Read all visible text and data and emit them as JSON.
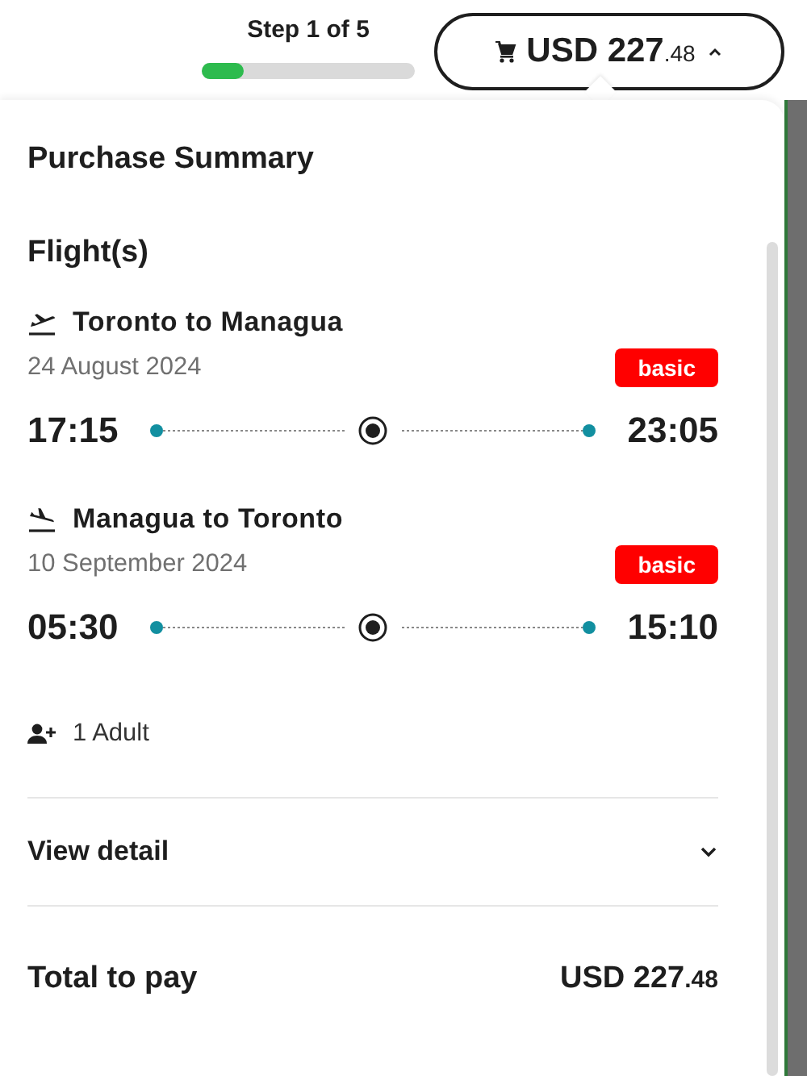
{
  "header": {
    "step": "Step 1 of 5",
    "progress": {
      "level": 0.2
    },
    "cart_button": {
      "amount": "USD 227",
      "cents": ".48",
      "expanded": true
    }
  },
  "summary": {
    "title": "Purchase Summary",
    "section_title": "Flight(s)",
    "flights": [
      {
        "kind": "departure",
        "route": "Toronto to Managua",
        "date": "24 August 2024",
        "fare": "basic",
        "depart_time": "17:15",
        "arrive_time": "23:05"
      },
      {
        "kind": "return",
        "route": "Managua to Toronto",
        "date": "10 September 2024",
        "fare": "basic",
        "depart_time": "05:30",
        "arrive_time": "15:10"
      }
    ],
    "passengers": "1 Adult",
    "view_detail": {
      "label": "View detail",
      "expanded": false
    },
    "total": {
      "label": "Total to pay",
      "amount": "USD 227",
      "cents": ".48"
    }
  }
}
